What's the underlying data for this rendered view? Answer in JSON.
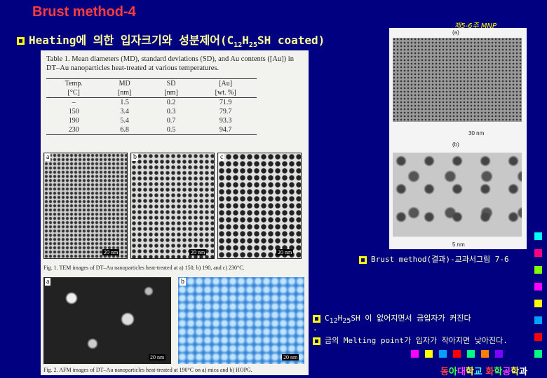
{
  "slide": {
    "title": "Brust method-4",
    "tag": "제5-6주 MNP",
    "headline_prefix": "Heating에 의한 입자크기와 성분제어(C",
    "headline_sub1": "12",
    "headline_mid": "H",
    "headline_sub2": "25",
    "headline_suffix": "SH coated)"
  },
  "table": {
    "caption": "Table 1. Mean diameters (MD), standard deviations (SD), and Au contents ([Au]) in DT–Au nanoparticles heat-treated at various temperatures.",
    "headers": [
      "Temp.",
      "MD",
      "SD",
      "[Au]"
    ],
    "units": [
      "[°C]",
      "[nm]",
      "[nm]",
      "[wt. %]"
    ],
    "rows": [
      [
        "–",
        "1.5",
        "0.2",
        "71.9"
      ],
      [
        "150",
        "3.4",
        "0.3",
        "79.7"
      ],
      [
        "190",
        "5.4",
        "0.7",
        "93.3"
      ],
      [
        "230",
        "6.8",
        "0.5",
        "94.7"
      ]
    ]
  },
  "tem": {
    "labels": [
      "a",
      "b",
      "c"
    ],
    "scale": "20 nm",
    "caption": "Fig. 1. TEM images of DT–Au nanoparticles heat-treated at a) 150, b) 190, and c) 230°C."
  },
  "afm": {
    "labels": [
      "a",
      "b"
    ],
    "scale": "20 nm",
    "caption": "Fig. 2. AFM images of DT–Au nanoparticles heat-treated at 190°C on a) mica and b) HOPG."
  },
  "sem": {
    "label_a": "(a)",
    "label_b": "(b)",
    "scale_a": "30 nm",
    "scale_b": "5 nm"
  },
  "notes": {
    "ref": "Brust method(결과)-교과서그림 7-6",
    "line1_prefix": "C",
    "line1_sub1": "12",
    "line1_mid": "H",
    "line1_sub2": "25",
    "line1_suffix": "SH 이 없어지면서 금입자가 커진다",
    "dot": ".",
    "line2": "금의 Melting point가 입자가 작아지면 낮아진다."
  },
  "footer": {
    "chars": [
      "동",
      "아",
      "대",
      "학",
      "교",
      " ",
      "화",
      "학",
      "공",
      "학",
      "과"
    ],
    "colors": [
      "#ff4040",
      "#40ff40",
      "#ff40ff",
      "#ffff40",
      "#40ffff",
      "#ffffff",
      "#ff4040",
      "#40ff40",
      "#ff40ff",
      "#ffff40",
      "#ffffff"
    ]
  },
  "decor": {
    "square_colors": [
      "#ff00ff",
      "#ffff00",
      "#00a0ff",
      "#ff0000",
      "#00ff80",
      "#ff8000",
      "#8000ff",
      "#00ffff",
      "#ff0080",
      "#80ff00"
    ]
  }
}
